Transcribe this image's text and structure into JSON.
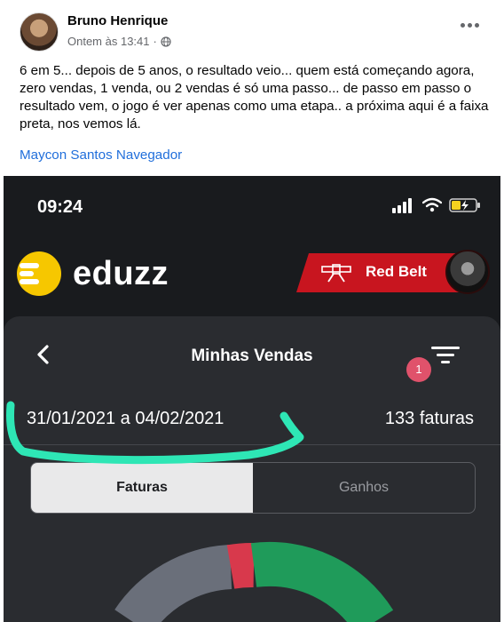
{
  "post": {
    "author": "Bruno Henrique",
    "time": "Ontem às 13:41",
    "separator": "·",
    "text": "6 em 5... depois de 5 anos, o resultado veio... quem está começando agora, zero vendas, 1 venda, ou 2 vendas é só uma passo... de passo em passo o resultado vem, o jogo é ver apenas como uma etapa.. a próxima aqui é a faixa preta, nos vemos lá.",
    "tagged": "Maycon Santos Navegador",
    "icons": {
      "privacy": "globe-icon",
      "menu": "more-options-icon"
    }
  },
  "screenshot": {
    "status_time": "09:24",
    "brand": "eduzz",
    "belt_label": "Red Belt",
    "screen_title": "Minhas Vendas",
    "filter_count": "1",
    "date_range": "31/01/2021 a 04/02/2021",
    "invoice_count": "133 faturas",
    "tabs": [
      {
        "label": "Faturas",
        "active": true
      },
      {
        "label": "Ganhos",
        "active": false
      }
    ],
    "colors": {
      "background": "#191b1e",
      "panel": "#2a2c30",
      "brand_yellow": "#f6c700",
      "belt_red": "#c8151f",
      "badge_pink": "#e0526b",
      "highlight_green": "#2ee6b5",
      "donut_green": "#1f9b5a",
      "donut_red": "#d8394c",
      "donut_gray": "#6a6f7a"
    }
  }
}
